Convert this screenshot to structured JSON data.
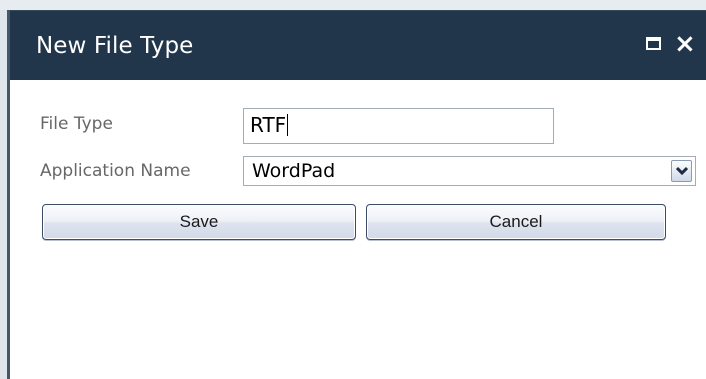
{
  "dialog": {
    "title": "New File Type",
    "maximize_icon": "maximize-icon",
    "close_label": "×"
  },
  "form": {
    "file_type_label": "File Type",
    "file_type_value": "RTF",
    "application_name_label": "Application Name",
    "application_name_value": "WordPad",
    "dropdown_icon": "chevron-down-icon"
  },
  "buttons": {
    "save_label": "Save",
    "cancel_label": "Cancel"
  },
  "colors": {
    "titlebar": "#21364a",
    "title_text": "#ffffff",
    "label_text": "#676767"
  }
}
